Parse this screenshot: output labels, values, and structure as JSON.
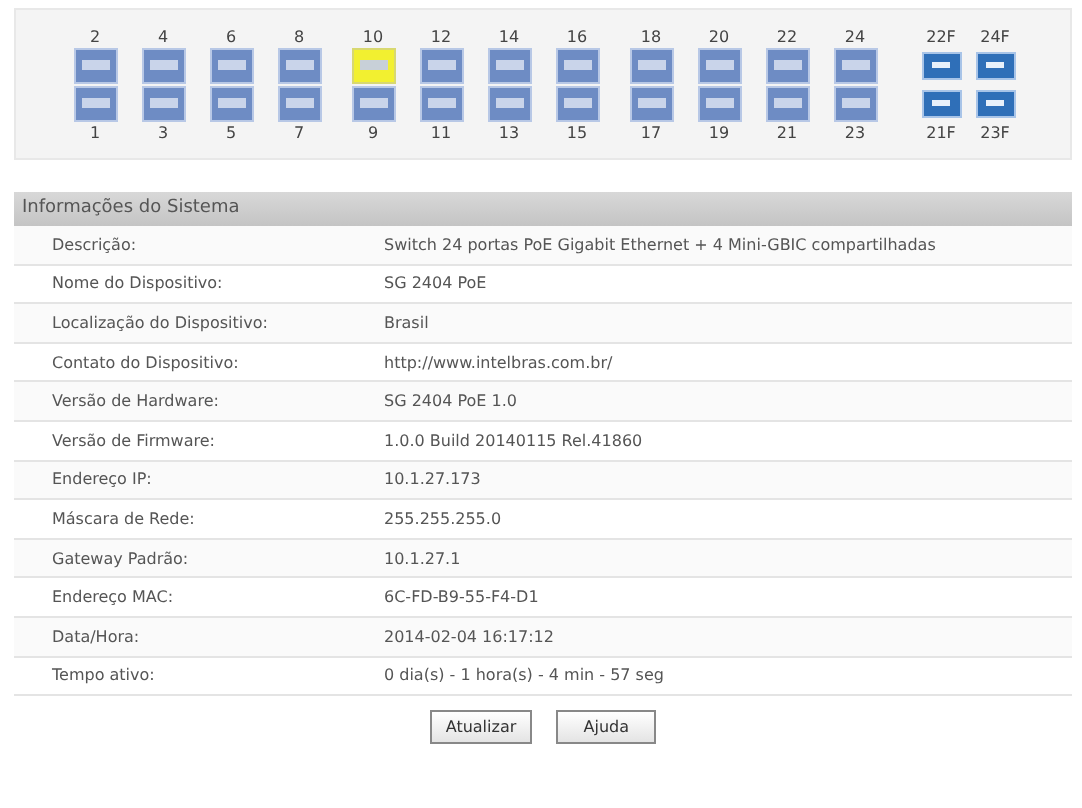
{
  "port_groups": [
    {
      "columns": [
        {
          "top": {
            "label": "2",
            "active": false
          },
          "bottom": {
            "label": "1",
            "active": false
          }
        },
        {
          "top": {
            "label": "4",
            "active": false
          },
          "bottom": {
            "label": "3",
            "active": false
          }
        },
        {
          "top": {
            "label": "6",
            "active": false
          },
          "bottom": {
            "label": "5",
            "active": false
          }
        },
        {
          "top": {
            "label": "8",
            "active": false
          },
          "bottom": {
            "label": "7",
            "active": false
          }
        }
      ]
    },
    {
      "columns": [
        {
          "top": {
            "label": "10",
            "active": true
          },
          "bottom": {
            "label": "9",
            "active": false
          }
        },
        {
          "top": {
            "label": "12",
            "active": false
          },
          "bottom": {
            "label": "11",
            "active": false
          }
        },
        {
          "top": {
            "label": "14",
            "active": false
          },
          "bottom": {
            "label": "13",
            "active": false
          }
        },
        {
          "top": {
            "label": "16",
            "active": false
          },
          "bottom": {
            "label": "15",
            "active": false
          }
        }
      ]
    },
    {
      "columns": [
        {
          "top": {
            "label": "18",
            "active": false
          },
          "bottom": {
            "label": "17",
            "active": false
          }
        },
        {
          "top": {
            "label": "20",
            "active": false
          },
          "bottom": {
            "label": "19",
            "active": false
          }
        },
        {
          "top": {
            "label": "22",
            "active": false
          },
          "bottom": {
            "label": "21",
            "active": false
          }
        },
        {
          "top": {
            "label": "24",
            "active": false
          },
          "bottom": {
            "label": "23",
            "active": false
          }
        }
      ]
    }
  ],
  "sfp_ports": [
    {
      "top": {
        "label": "22F",
        "active": false
      },
      "bottom": {
        "label": "21F",
        "active": false
      }
    },
    {
      "top": {
        "label": "24F",
        "active": false
      },
      "bottom": {
        "label": "23F",
        "active": false
      }
    }
  ],
  "system_info": {
    "title": "Informações do Sistema",
    "rows": [
      {
        "label": "Descrição:",
        "value": "Switch 24 portas PoE Gigabit Ethernet + 4 Mini-GBIC compartilhadas"
      },
      {
        "label": "Nome do Dispositivo:",
        "value": "SG 2404 PoE"
      },
      {
        "label": "Localização do Dispositivo:",
        "value": "Brasil"
      },
      {
        "label": "Contato do Dispositivo:",
        "value": "http://www.intelbras.com.br/"
      },
      {
        "label": "Versão de Hardware:",
        "value": "SG 2404 PoE 1.0"
      },
      {
        "label": "Versão de Firmware:",
        "value": "1.0.0 Build 20140115 Rel.41860"
      },
      {
        "label": "Endereço IP:",
        "value": "10.1.27.173"
      },
      {
        "label": "Máscara de Rede:",
        "value": "255.255.255.0"
      },
      {
        "label": "Gateway Padrão:",
        "value": "10.1.27.1"
      },
      {
        "label": "Endereço MAC:",
        "value": "6C-FD-B9-55-F4-D1"
      },
      {
        "label": "Data/Hora:",
        "value": "2014-02-04 16:17:12"
      },
      {
        "label": "Tempo ativo:",
        "value": "0 dia(s) - 1 hora(s) - 4 min - 57 seg"
      }
    ]
  },
  "buttons": [
    "Atualizar",
    "Ajuda"
  ]
}
